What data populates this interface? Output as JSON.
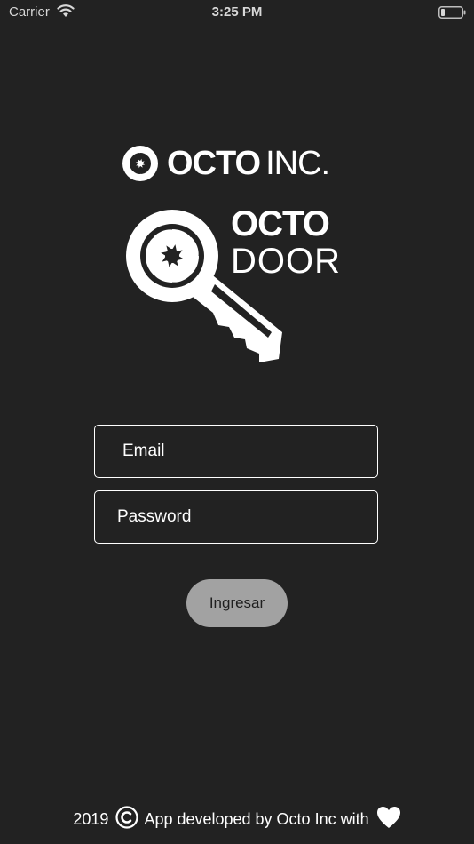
{
  "status_bar": {
    "carrier": "Carrier",
    "time": "3:25 PM",
    "icons": [
      "wifi-icon",
      "battery-icon"
    ]
  },
  "branding": {
    "company_bold": "OCTO",
    "company_light": "INC.",
    "app_line1": "OCTO",
    "app_line2": "DOOR",
    "icons": [
      "octo-aperture-icon",
      "key-icon"
    ]
  },
  "login_form": {
    "email_placeholder": "Email",
    "password_placeholder": "Password",
    "submit_label": "Ingresar"
  },
  "footer": {
    "year": "2019",
    "text": "App developed by Octo Inc with",
    "icons": [
      "copyright-icon",
      "heart-icon"
    ]
  },
  "colors": {
    "background": "#222222",
    "text": "#ffffff",
    "button_bg": "#a2a2a2",
    "button_text": "#1f1f1f"
  }
}
